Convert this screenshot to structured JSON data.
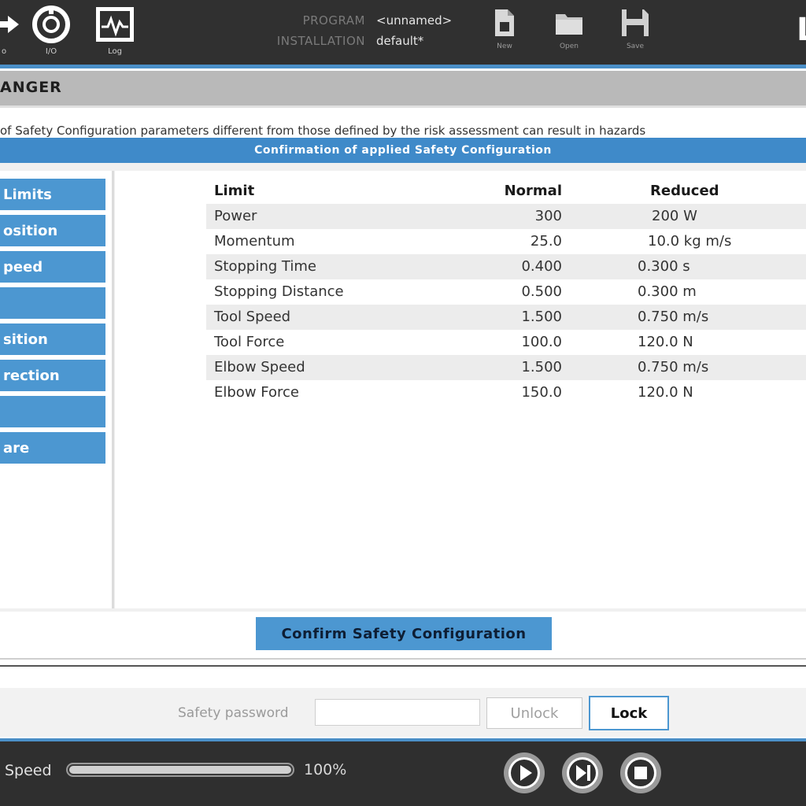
{
  "toolbar": {
    "left_buttons": [
      {
        "label": "o",
        "icon": "move-arrow-icon"
      },
      {
        "label": "I/O",
        "icon": "io-dial-icon"
      },
      {
        "label": "Log",
        "icon": "log-graph-icon"
      }
    ],
    "program_label": "PROGRAM",
    "program_value": "<unnamed>",
    "installation_label": "INSTALLATION",
    "installation_value": "default*",
    "file_buttons": [
      {
        "label": "New",
        "icon": "new-file-icon"
      },
      {
        "label": "Open",
        "icon": "folder-icon"
      },
      {
        "label": "Save",
        "icon": "save-icon"
      }
    ],
    "right_glyph": "L"
  },
  "title": "ANGER",
  "warning_text": "of Safety Configuration parameters different from those defined by the risk assessment can result in hazards",
  "dialog": {
    "title": "Confirmation of applied Safety Configuration",
    "sidebar_items": [
      "Limits",
      "osition",
      "peed",
      "",
      "sition",
      "rection",
      "",
      "are"
    ],
    "table": {
      "headers": [
        "Limit",
        "Normal",
        "Reduced"
      ],
      "rows": [
        {
          "name": "Power",
          "normal": "300",
          "reduced": "200 W"
        },
        {
          "name": "Momentum",
          "normal": "25.0",
          "reduced": "10.0 kg m/s"
        },
        {
          "name": "Stopping Time",
          "normal": "0.400",
          "reduced": "0.300 s"
        },
        {
          "name": "Stopping Distance",
          "normal": "0.500",
          "reduced": "0.300 m"
        },
        {
          "name": "Tool Speed",
          "normal": "1.500",
          "reduced": "0.750 m/s"
        },
        {
          "name": "Tool Force",
          "normal": "100.0",
          "reduced": "120.0 N"
        },
        {
          "name": "Elbow Speed",
          "normal": "1.500",
          "reduced": "0.750 m/s"
        },
        {
          "name": "Elbow Force",
          "normal": "150.0",
          "reduced": "120.0 N"
        }
      ]
    },
    "confirm_label": "Confirm Safety Configuration"
  },
  "password": {
    "label": "Safety password",
    "value": "",
    "unlock_label": "Unlock",
    "lock_label": "Lock"
  },
  "footer": {
    "speed_label": "Speed",
    "speed_value": "100%",
    "speed_fraction": 1.0,
    "controls": [
      {
        "icon": "play-icon"
      },
      {
        "icon": "step-icon"
      },
      {
        "icon": "stop-icon"
      }
    ]
  },
  "colors": {
    "accent": "#4c97d1",
    "topbar": "#303030",
    "title_strip": "#b9b9b9"
  }
}
